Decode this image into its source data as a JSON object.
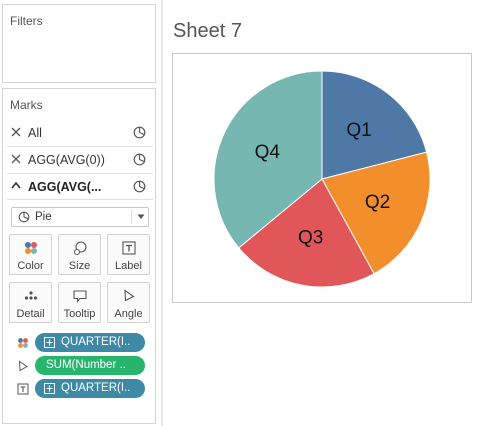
{
  "filters": {
    "title": "Filters"
  },
  "marks": {
    "title": "Marks",
    "rows": [
      {
        "label": "All"
      },
      {
        "label": "AGG(AVG(0))"
      },
      {
        "label": "AGG(AVG(..."
      }
    ],
    "mark_type": "Pie",
    "buttons": [
      {
        "label": "Color",
        "icon": "color-dots-icon"
      },
      {
        "label": "Size",
        "icon": "size-icon"
      },
      {
        "label": "Label",
        "icon": "label-icon"
      },
      {
        "label": "Detail",
        "icon": "detail-icon"
      },
      {
        "label": "Tooltip",
        "icon": "tooltip-icon"
      },
      {
        "label": "Angle",
        "icon": "angle-icon"
      }
    ],
    "pills": [
      {
        "label": "QUARTER(I..",
        "icon": "color-dots-icon",
        "color": "#3e8aa6"
      },
      {
        "label": "SUM(Number ..",
        "icon": "angle-icon",
        "color": "#27b56e"
      },
      {
        "label": "QUARTER(I..",
        "icon": "label-icon",
        "color": "#3e8aa6"
      }
    ]
  },
  "sheet": {
    "title": "Sheet 7"
  },
  "chart_data": {
    "type": "pie",
    "categories": [
      "Q1",
      "Q2",
      "Q3",
      "Q4"
    ],
    "values": [
      21,
      21,
      22,
      36
    ],
    "colors": [
      "#4e79a7",
      "#f28e2b",
      "#e15759",
      "#76b7b2"
    ]
  }
}
